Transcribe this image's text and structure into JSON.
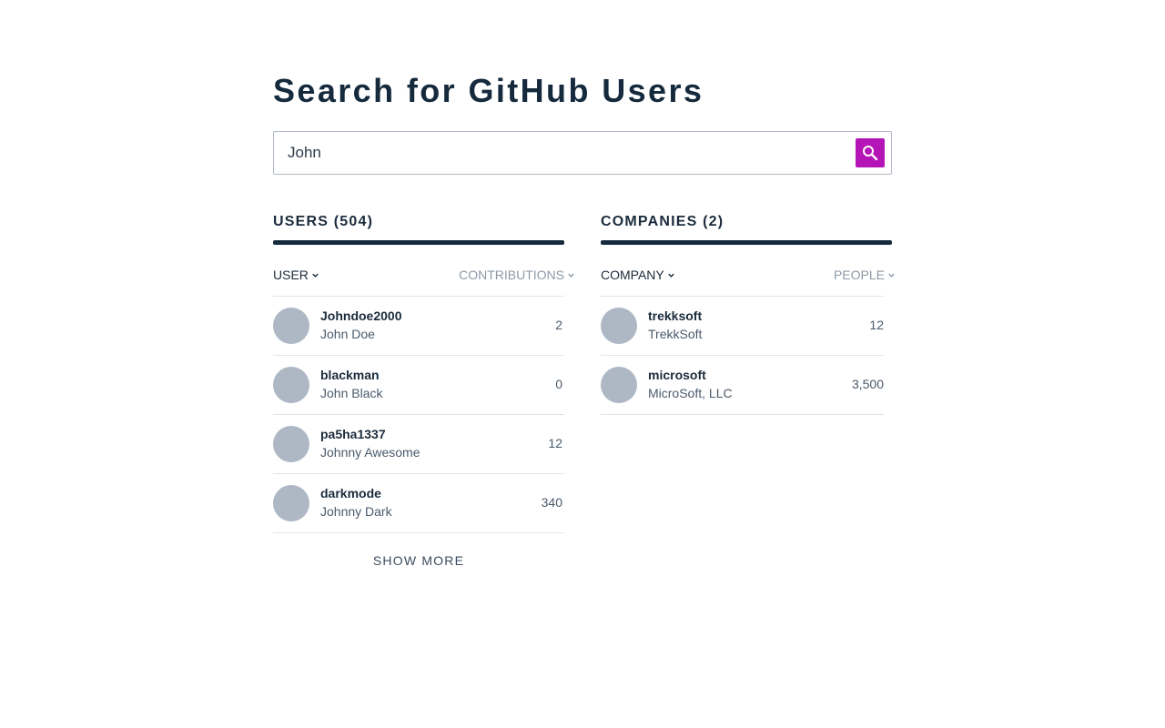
{
  "title": "Search for GitHub Users",
  "search": {
    "value": "John",
    "button_icon": "search-icon",
    "button_color": "#b515b6"
  },
  "users": {
    "heading": "USERS (504)",
    "sort_left": "USER",
    "sort_right": "CONTRIBUTIONS",
    "rows": [
      {
        "username": "Johndoe2000",
        "name": "John Doe",
        "count": "2"
      },
      {
        "username": "blackman",
        "name": "John Black",
        "count": "0"
      },
      {
        "username": "pa5ha1337",
        "name": "Johnny Awesome",
        "count": "12"
      },
      {
        "username": "darkmode",
        "name": "Johnny Dark",
        "count": "340"
      }
    ],
    "show_more": "SHOW MORE"
  },
  "companies": {
    "heading": "COMPANIES (2)",
    "sort_left": "COMPANY",
    "sort_right": "PEOPLE",
    "rows": [
      {
        "username": "trekksoft",
        "name": "TrekkSoft",
        "count": "12"
      },
      {
        "username": "microsoft",
        "name": "MicroSoft, LLC",
        "count": "3,500"
      }
    ]
  },
  "colors": {
    "heading": "#152a3d",
    "avatar": "#adb8c4",
    "accent": "#b515b6"
  }
}
